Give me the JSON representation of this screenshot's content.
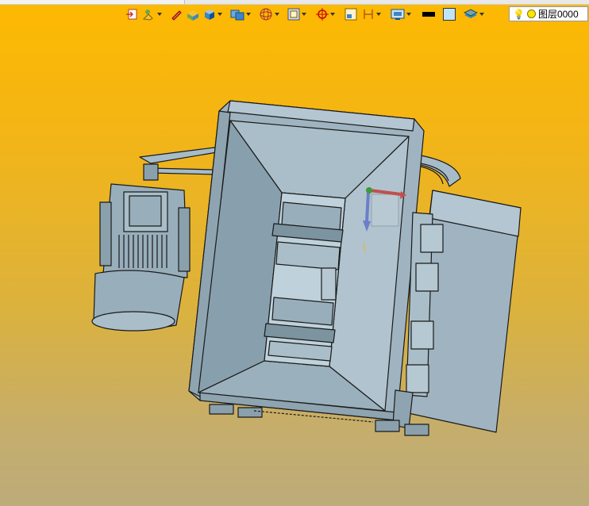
{
  "toolbar": {
    "items": [
      {
        "name": "import-icon"
      },
      {
        "name": "fill-icon"
      },
      {
        "name": "pencil-icon"
      },
      {
        "name": "box-yellow-icon"
      },
      {
        "name": "cube-icon"
      },
      {
        "name": "solid-view-icon"
      },
      {
        "name": "wireframe-sphere-icon"
      },
      {
        "name": "frame-icon"
      },
      {
        "name": "snap-icon"
      },
      {
        "name": "layout-icon"
      },
      {
        "name": "dimension-icon"
      },
      {
        "name": "display-settings-icon"
      },
      {
        "name": "line-color-swatch"
      },
      {
        "name": "fill-color-swatch"
      },
      {
        "name": "layer-stack-icon"
      }
    ],
    "colors": {
      "line_color": "#000000",
      "fill_color": "#bfe4f6"
    }
  },
  "layer": {
    "name": "图层0000",
    "bulb_icon": "lightbulb-icon",
    "status_color": "#ffe600"
  },
  "viewport": {
    "background_top": "#fdb900",
    "background_bottom": "#bcac7a",
    "model_color": "#98aebb"
  }
}
